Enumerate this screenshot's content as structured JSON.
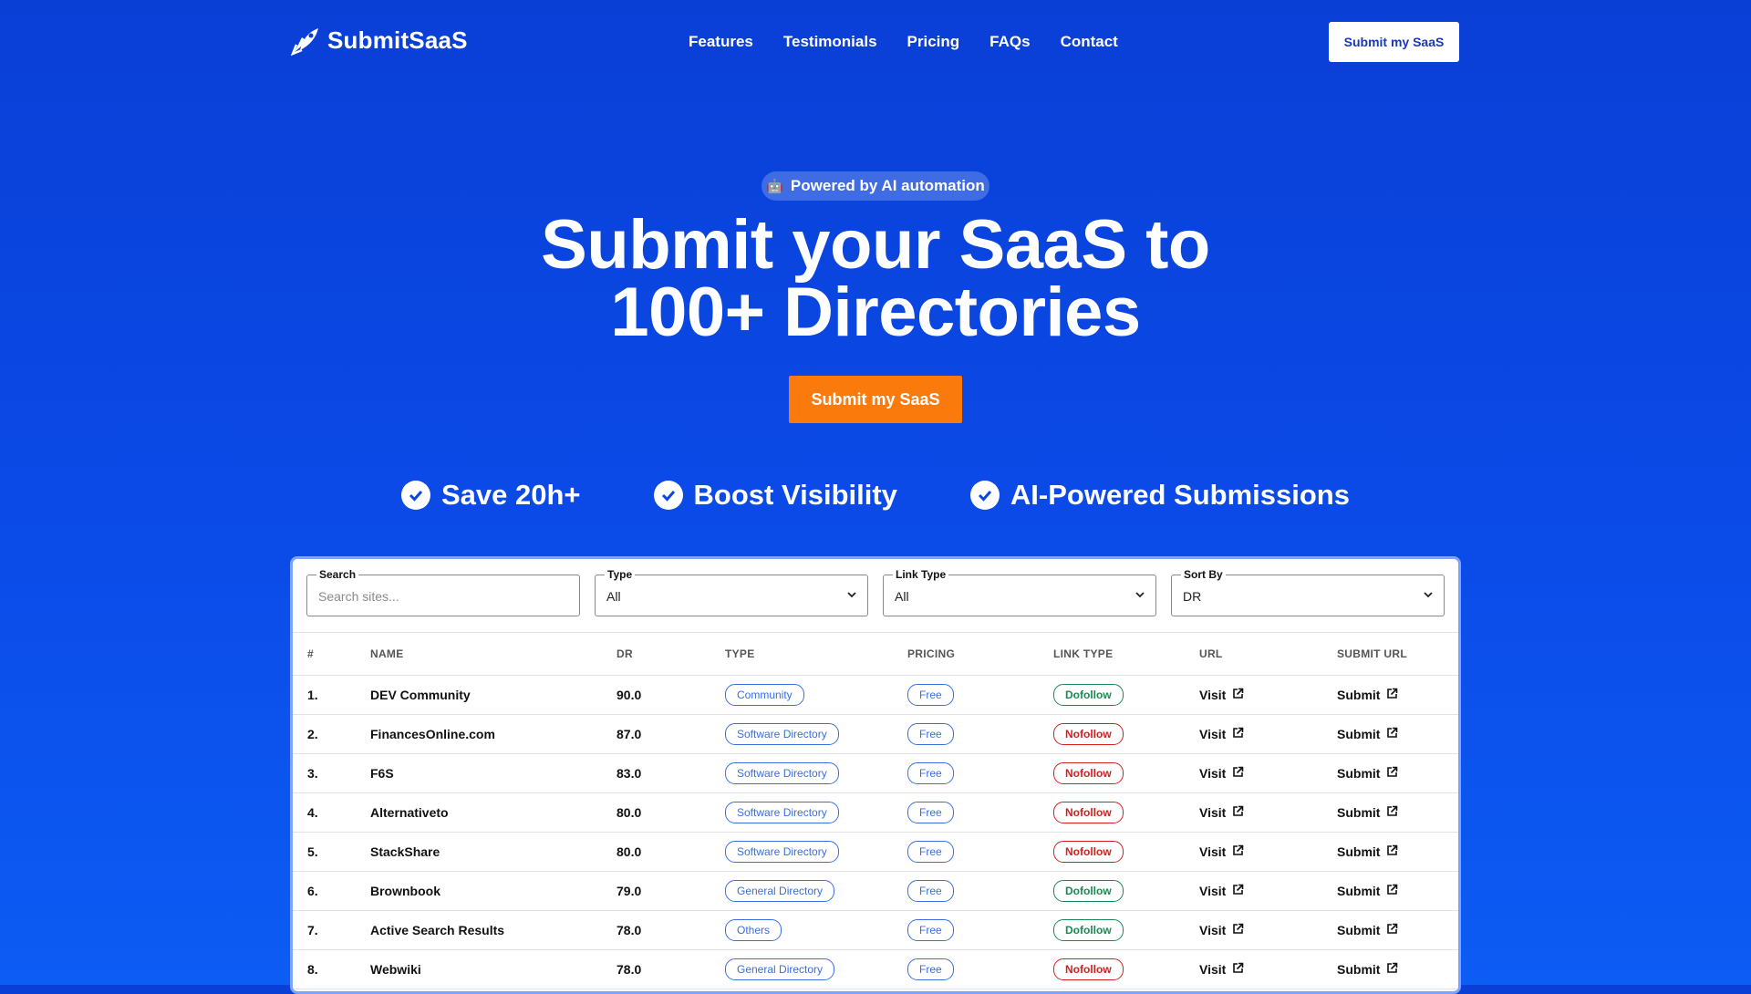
{
  "brand": {
    "name": "SubmitSaaS"
  },
  "nav": {
    "links": [
      "Features",
      "Testimonials",
      "Pricing",
      "FAQs",
      "Contact"
    ],
    "cta": "Submit my SaaS"
  },
  "hero": {
    "badge": "Powered by AI automation",
    "title_line1": "Submit your SaaS to",
    "title_line2": "100+ Directories",
    "cta": "Submit my SaaS"
  },
  "features": [
    "Save 20h+",
    "Boost Visibility",
    "AI-Powered Submissions"
  ],
  "filters": {
    "search": {
      "label": "Search",
      "placeholder": "Search sites..."
    },
    "type": {
      "label": "Type",
      "value": "All"
    },
    "link_type": {
      "label": "Link Type",
      "value": "All"
    },
    "sort_by": {
      "label": "Sort By",
      "value": "DR"
    }
  },
  "table": {
    "headers": [
      "#",
      "NAME",
      "DR",
      "TYPE",
      "PRICING",
      "LINK TYPE",
      "URL",
      "SUBMIT URL"
    ],
    "visit_label": "Visit",
    "submit_label": "Submit",
    "rows": [
      {
        "n": "1.",
        "name": "DEV Community",
        "dr": "90.0",
        "type": "Community",
        "pricing": "Free",
        "link_type": "Dofollow"
      },
      {
        "n": "2.",
        "name": "FinancesOnline.com",
        "dr": "87.0",
        "type": "Software Directory",
        "pricing": "Free",
        "link_type": "Nofollow"
      },
      {
        "n": "3.",
        "name": "F6S",
        "dr": "83.0",
        "type": "Software Directory",
        "pricing": "Free",
        "link_type": "Nofollow"
      },
      {
        "n": "4.",
        "name": "Alternativeto",
        "dr": "80.0",
        "type": "Software Directory",
        "pricing": "Free",
        "link_type": "Nofollow"
      },
      {
        "n": "5.",
        "name": "StackShare",
        "dr": "80.0",
        "type": "Software Directory",
        "pricing": "Free",
        "link_type": "Nofollow"
      },
      {
        "n": "6.",
        "name": "Brownbook",
        "dr": "79.0",
        "type": "General Directory",
        "pricing": "Free",
        "link_type": "Dofollow"
      },
      {
        "n": "7.",
        "name": "Active Search Results",
        "dr": "78.0",
        "type": "Others",
        "pricing": "Free",
        "link_type": "Dofollow"
      },
      {
        "n": "8.",
        "name": "Webwiki",
        "dr": "78.0",
        "type": "General Directory",
        "pricing": "Free",
        "link_type": "Nofollow"
      }
    ]
  }
}
